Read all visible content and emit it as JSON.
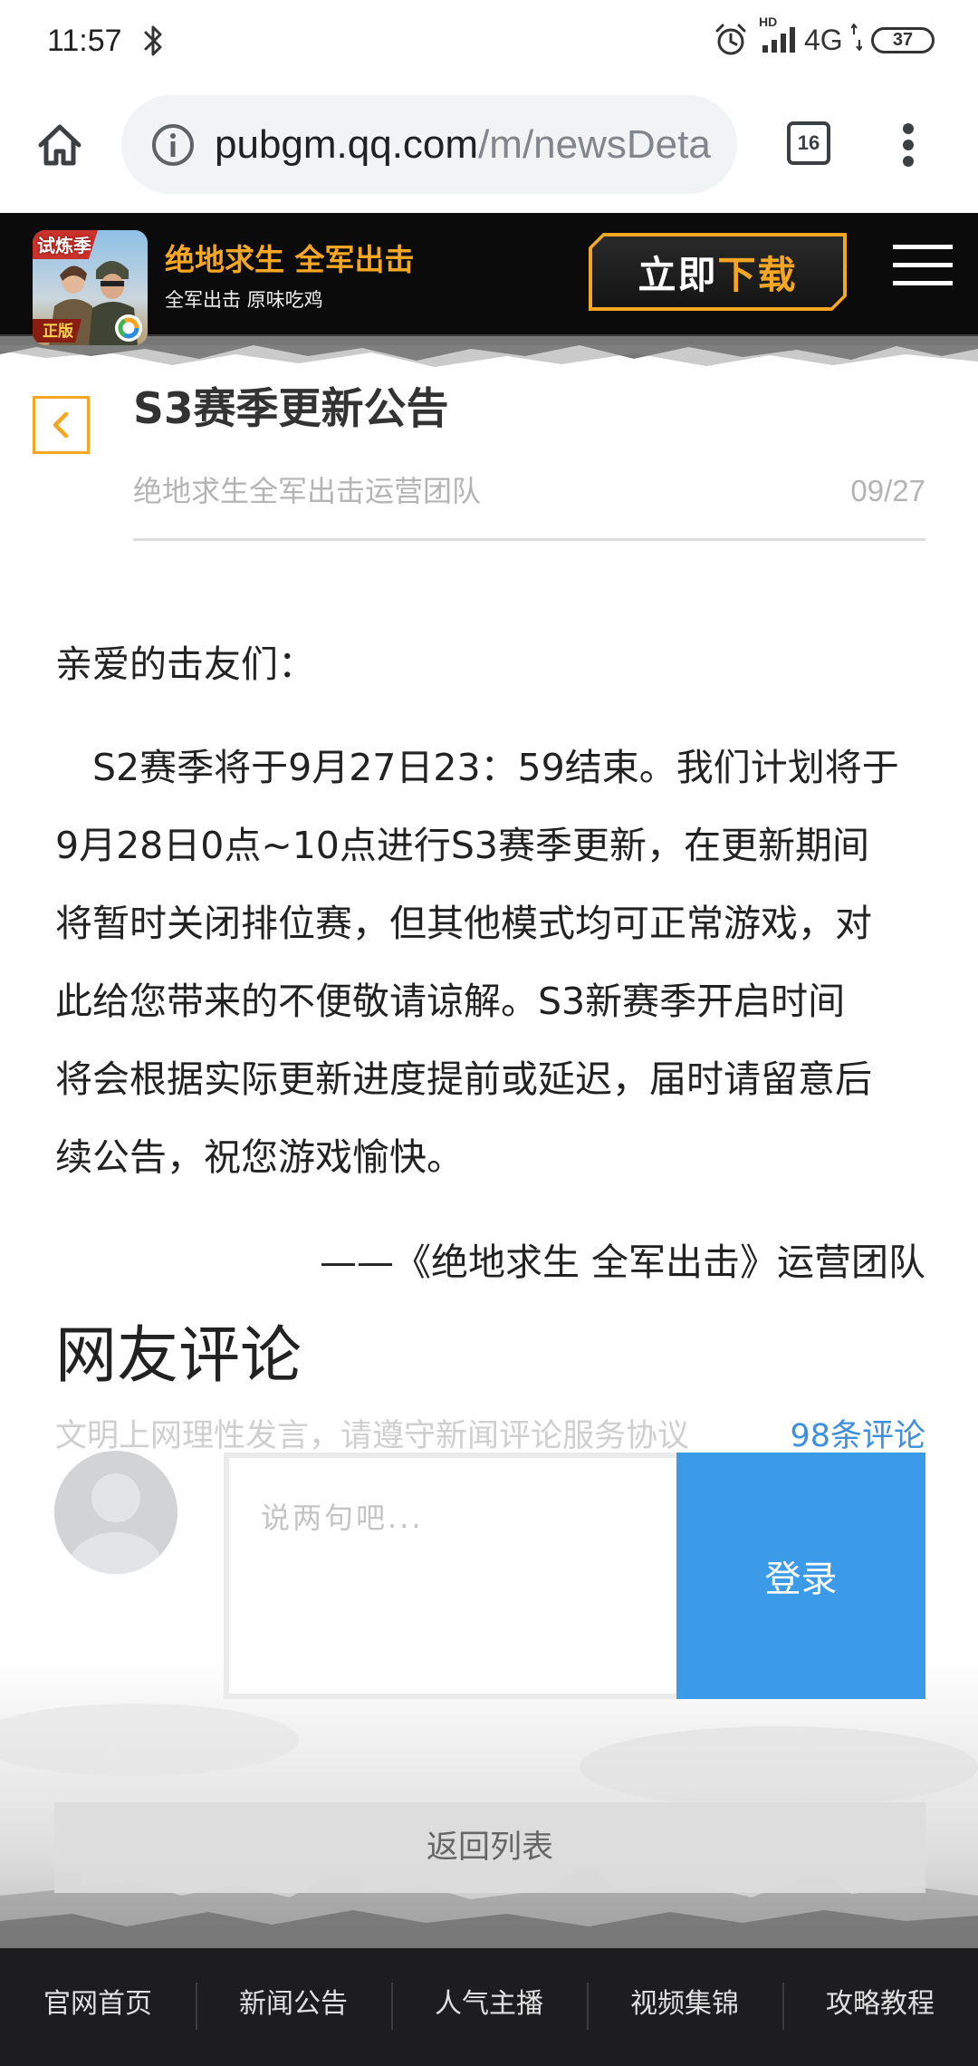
{
  "status_bar": {
    "time": "11:57",
    "hd_label": "HD",
    "network": "4G",
    "battery": "37"
  },
  "browser": {
    "url_host": "pubgm.qq.com",
    "url_path": "/m/newsDeta",
    "tab_count": "16"
  },
  "site_header": {
    "title": "绝地求生 全军出击",
    "subtitle": "全军出击 原味吃鸡",
    "logo_badge_top": "试炼季",
    "logo_badge_bottom": "正版",
    "download_part1": "立即",
    "download_part2": "下载"
  },
  "article": {
    "title": "S3赛季更新公告",
    "author": "绝地求生全军出击运营团队",
    "date": "09/27",
    "greeting": "亲爱的击友们：",
    "body_lines": [
      "S2赛季将于9月27日23：59结束。我们计划将于",
      "9月28日0点~10点进行S3赛季更新，在更新期间",
      "将暂时关闭排位赛，但其他模式均可正常游戏，对",
      "此给您带来的不便敬请谅解。S3新赛季开启时间",
      "将会根据实际更新进度提前或延迟，届时请留意后",
      "续公告，祝您游戏愉快。"
    ],
    "signature": "——《绝地求生 全军出击》运营团队"
  },
  "comments": {
    "heading": "网友评论",
    "notice": "文明上网理性发言，请遵守新闻评论服务协议",
    "count": "98条评论",
    "placeholder": "说两句吧...",
    "login_label": "登录"
  },
  "return_label": "返回列表",
  "bottom_nav": [
    "官网首页",
    "新闻公告",
    "人气主播",
    "视频集锦",
    "攻略教程"
  ],
  "colors": {
    "accent": "#f5a623",
    "link_blue": "#3d8fe0",
    "button_blue": "#3b9be8",
    "header_bg": "#0b0b0b",
    "nav_bg": "#1d1d1f"
  },
  "icons": {
    "bluetooth": "bluetooth-icon",
    "alarm": "alarm-icon",
    "signal": "signal-icon",
    "battery": "battery-icon",
    "home": "home-icon",
    "info": "info-icon",
    "tabs": "tabs-icon",
    "menu": "menu-dots-icon",
    "hamburger": "hamburger-menu-icon",
    "back": "back-chevron-icon",
    "avatar": "avatar-placeholder-icon"
  }
}
